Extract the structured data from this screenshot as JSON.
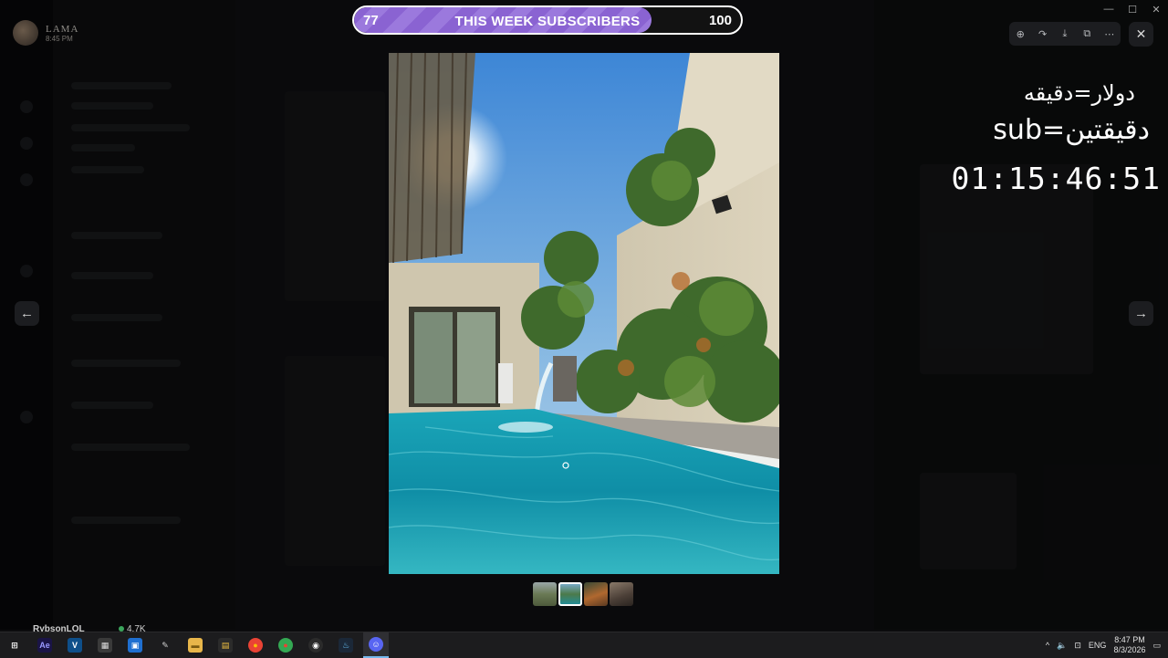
{
  "server": {
    "name": "LAMA",
    "time": "8:45 PM"
  },
  "subscriber_goal": {
    "label": "THIS WEEK SUBSCRIBERS",
    "current": "77",
    "goal": "100",
    "progress": 0.77,
    "fill_color": "#8a63d2"
  },
  "overlay": {
    "line1": "دولار=دقيقه",
    "line2": "sub=دقيقتين",
    "timer": "01:15:46:51"
  },
  "viewer": {
    "toolbar": [
      {
        "name": "zoom-icon",
        "glyph": "⊕"
      },
      {
        "name": "forward-icon",
        "glyph": "↷"
      },
      {
        "name": "download-icon",
        "glyph": "⤓"
      },
      {
        "name": "open-external-icon",
        "glyph": "⧉"
      },
      {
        "name": "more-icon",
        "glyph": "⋯"
      }
    ],
    "close_glyph": "✕",
    "prev_glyph": "←",
    "next_glyph": "→"
  },
  "window_controls": {
    "minimize": "—",
    "maximize": "☐",
    "close": "✕"
  },
  "bottom": {
    "username": "RybsonLOL",
    "member_count": "4.7K"
  },
  "taskbar": {
    "apps": [
      {
        "name": "windows-start-icon",
        "glyph": "⊞",
        "bg": "transparent",
        "fg": "#ffffff"
      },
      {
        "name": "after-effects-icon",
        "glyph": "Ae",
        "bg": "#1a1446",
        "fg": "#9999ff"
      },
      {
        "name": "visual-studio-icon",
        "glyph": "V",
        "bg": "#0e4f8a",
        "fg": "#ffffff"
      },
      {
        "name": "calculator-icon",
        "glyph": "▦",
        "bg": "#3a3a3a",
        "fg": "#dddddd"
      },
      {
        "name": "taskbar-app-blue-icon",
        "glyph": "▣",
        "bg": "#1f6fd0",
        "fg": "#ffffff"
      },
      {
        "name": "paint-icon",
        "glyph": "✎",
        "bg": "transparent",
        "fg": "#cfcfcf"
      },
      {
        "name": "file-explorer-icon",
        "glyph": "▬",
        "bg": "#e8b64a",
        "fg": "#7a5a10"
      },
      {
        "name": "microsoft-store-icon",
        "glyph": "▤",
        "bg": "#2b2b2b",
        "fg": "#f0c040"
      },
      {
        "name": "chrome-icon",
        "glyph": "●",
        "bg": "#ea4335",
        "fg": "#fbbc05"
      },
      {
        "name": "chrome-profile-icon",
        "glyph": "●",
        "bg": "#34a853",
        "fg": "#ea4335"
      },
      {
        "name": "obs-icon",
        "glyph": "◉",
        "bg": "#2b2b2b",
        "fg": "#ffffff"
      },
      {
        "name": "steam-icon",
        "glyph": "♨",
        "bg": "#1b2838",
        "fg": "#66c0f4"
      },
      {
        "name": "discord-icon",
        "glyph": "☺",
        "bg": "#5865f2",
        "fg": "#ffffff"
      }
    ],
    "tray": {
      "chevron": "^",
      "volume": "🔈",
      "network": "⊡",
      "lang": "ENG",
      "time": "8:47 PM",
      "date": "8/3/2026",
      "notify": "▭"
    }
  }
}
